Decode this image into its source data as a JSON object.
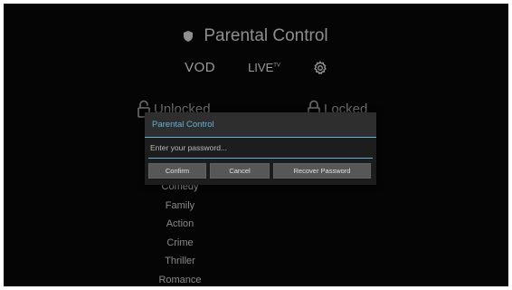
{
  "header": {
    "title": "Parental Control",
    "icon": "shield-icon"
  },
  "nav": {
    "vod_label": "VOD",
    "live_label": "LIVE",
    "live_sup": "TV",
    "settings_icon": "gear-icon"
  },
  "tabs": {
    "unlocked_label": "Unlocked",
    "locked_label": "Locked"
  },
  "categories": [
    "Comedy",
    "Family",
    "Action",
    "Crime",
    "Thriller",
    "Romance"
  ],
  "dialog": {
    "title": "Parental Control",
    "password_placeholder": "Enter your password...",
    "password_value": "",
    "confirm_label": "Confirm",
    "cancel_label": "Cancel",
    "recover_label": "Recover Password"
  },
  "colors": {
    "accent": "#5fb3d9",
    "background": "#050505",
    "dialog": "#2e2e2e"
  }
}
